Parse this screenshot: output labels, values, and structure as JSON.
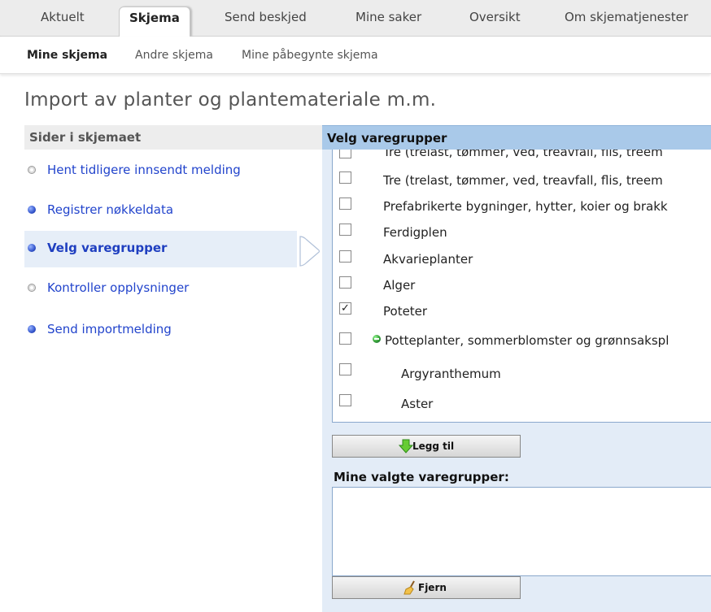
{
  "top_tabs": [
    "Aktuelt",
    "Skjema",
    "Send beskjed",
    "Mine saker",
    "Oversikt",
    "Om skjematjenester"
  ],
  "sub_nav": [
    "Mine skjema",
    "Andre skjema",
    "Mine påbegynte skjema"
  ],
  "page_title": "Import av planter og plantemateriale m.m.",
  "sidebar": {
    "heading": "Sider i skjemaet",
    "items": [
      {
        "label": "Hent tidligere innsendt melding",
        "status": "grey"
      },
      {
        "label": "Registrer nøkkeldata",
        "status": "blue"
      },
      {
        "label": "Velg varegrupper",
        "status": "blue",
        "active": true
      },
      {
        "label": "Kontroller opplysninger",
        "status": "grey"
      },
      {
        "label": "Send importmelding",
        "status": "blue"
      }
    ]
  },
  "main": {
    "heading": "Velg varegrupper",
    "items": [
      {
        "label": "Tre (trelast, tømmer, ved, treavfall, flis, treem",
        "checked": false
      },
      {
        "label": "Tre (trelast, tømmer, ved, treavfall, flis, treem",
        "checked": false
      },
      {
        "label": "Prefabrikerte bygninger, hytter, koier og brakk",
        "checked": false
      },
      {
        "label": "Ferdigplen",
        "checked": false
      },
      {
        "label": "Akvarieplanter",
        "checked": false
      },
      {
        "label": "Alger",
        "checked": false
      },
      {
        "label": "Poteter",
        "checked": true
      },
      {
        "label": "Potteplanter, sommerblomster og grønnsakspl",
        "checked": false,
        "expanded": true
      },
      {
        "label": "Argyranthemum",
        "checked": false,
        "child": true
      },
      {
        "label": "Aster",
        "checked": false,
        "child": true
      }
    ],
    "add_button": "Legg til",
    "selected_label": "Mine valgte varegrupper:",
    "remove_button": "Fjern"
  },
  "colors": {
    "link": "#2244cc",
    "header_blue": "#a9c9e9",
    "panel_bg": "#e3ecf7"
  }
}
